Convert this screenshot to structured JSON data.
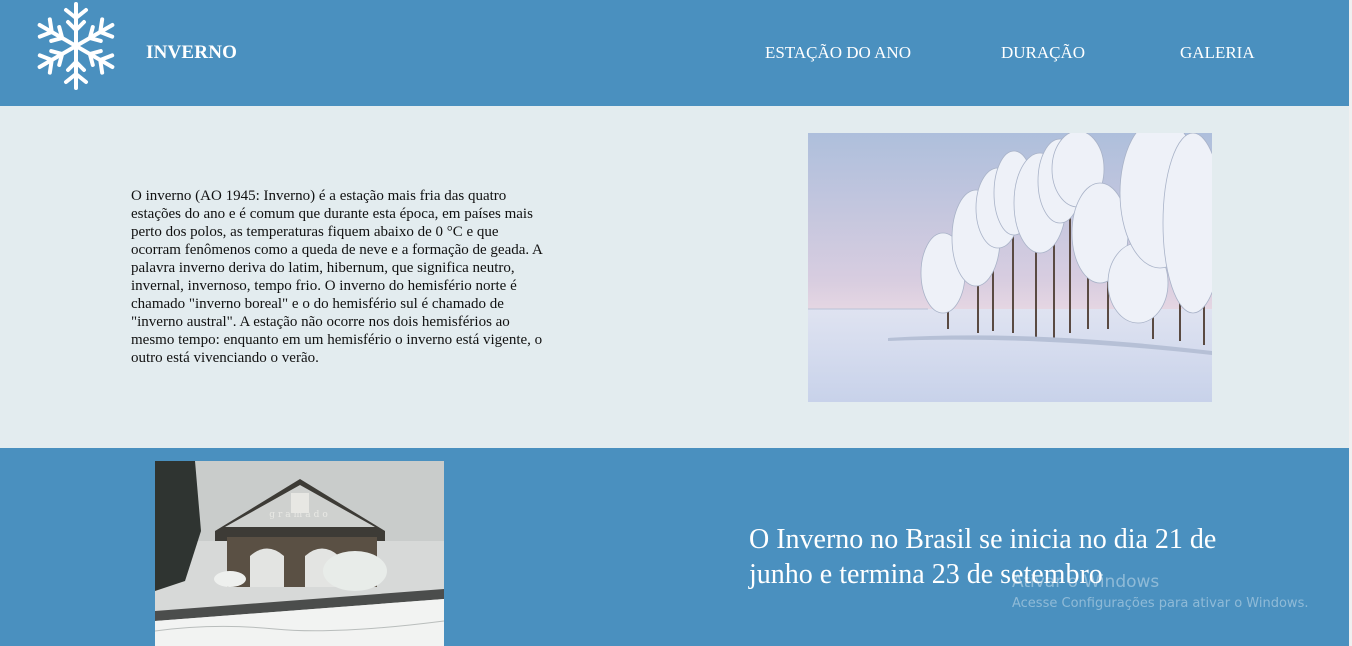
{
  "header": {
    "brand": "INVERNO",
    "nav": [
      "ESTAÇÃO DO ANO",
      "DURAÇÃO",
      "GALERIA"
    ],
    "logo_icon": "snowflake-icon",
    "bg_color": "#4a90bf"
  },
  "section1": {
    "paragraph": "O inverno (AO 1945: Inverno) é a estação mais fria das quatro estações do ano e é comum que durante esta época, em países mais perto dos polos, as temperaturas fiquem abaixo de 0 °C e que ocorram fenômenos como a queda de neve e a formação de geada. A palavra inverno deriva do latim, hibernum, que significa neutro, invernal, invernoso, tempo frio. O inverno do hemisfério norte é chamado \"inverno boreal\" e o do hemisfério sul é chamado de \"inverno austral\". A estação não ocorre nos dois hemisférios ao mesmo tempo: enquanto em um hemisfério o inverno está vigente, o outro está vivenciando o verão.",
    "bg_color": "#e3ecef"
  },
  "section2": {
    "heading": "O Inverno no Brasil se inicia no dia 21 de junho e termina 23 de setembro",
    "bg_color": "#4a90bf"
  },
  "watermark": {
    "line1": "Ativar o Windows",
    "line2": "Acesse Configurações para ativar o Windows."
  }
}
